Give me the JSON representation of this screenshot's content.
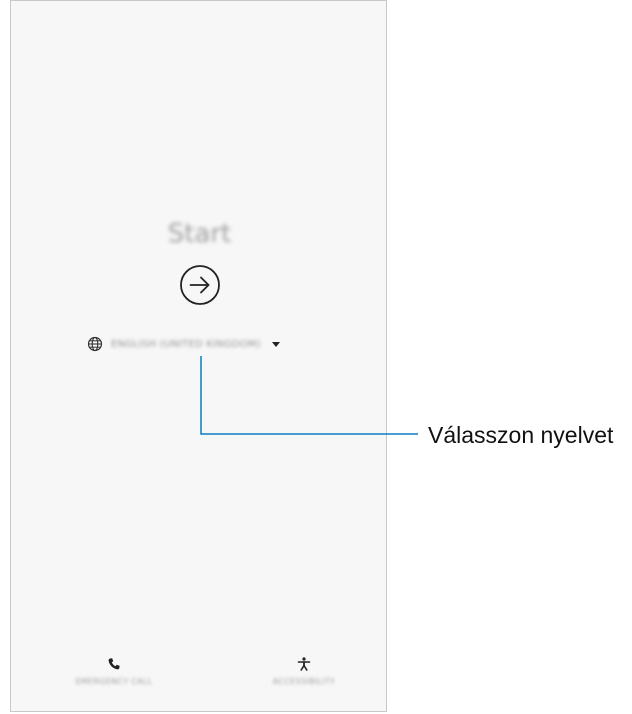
{
  "screen": {
    "title": "Start",
    "language": {
      "selected": "ENGLISH (UNITED KINGDOM)",
      "globe_icon": "globe-icon",
      "dropdown_icon": "dropdown-arrow-icon"
    },
    "start_icon": "arrow-right-circle-icon",
    "bottom": {
      "emergency_label": "EMERGENCY CALL",
      "emergency_icon": "phone-icon",
      "accessibility_label": "ACCESSIBILITY",
      "accessibility_icon": "accessibility-icon"
    }
  },
  "callout": {
    "label": "Válasszon nyelvet",
    "color": "#0b7fc1"
  },
  "colors": {
    "screen_background": "#f7f7f7",
    "screen_border": "#c9c9c9",
    "icon": "#222222"
  }
}
